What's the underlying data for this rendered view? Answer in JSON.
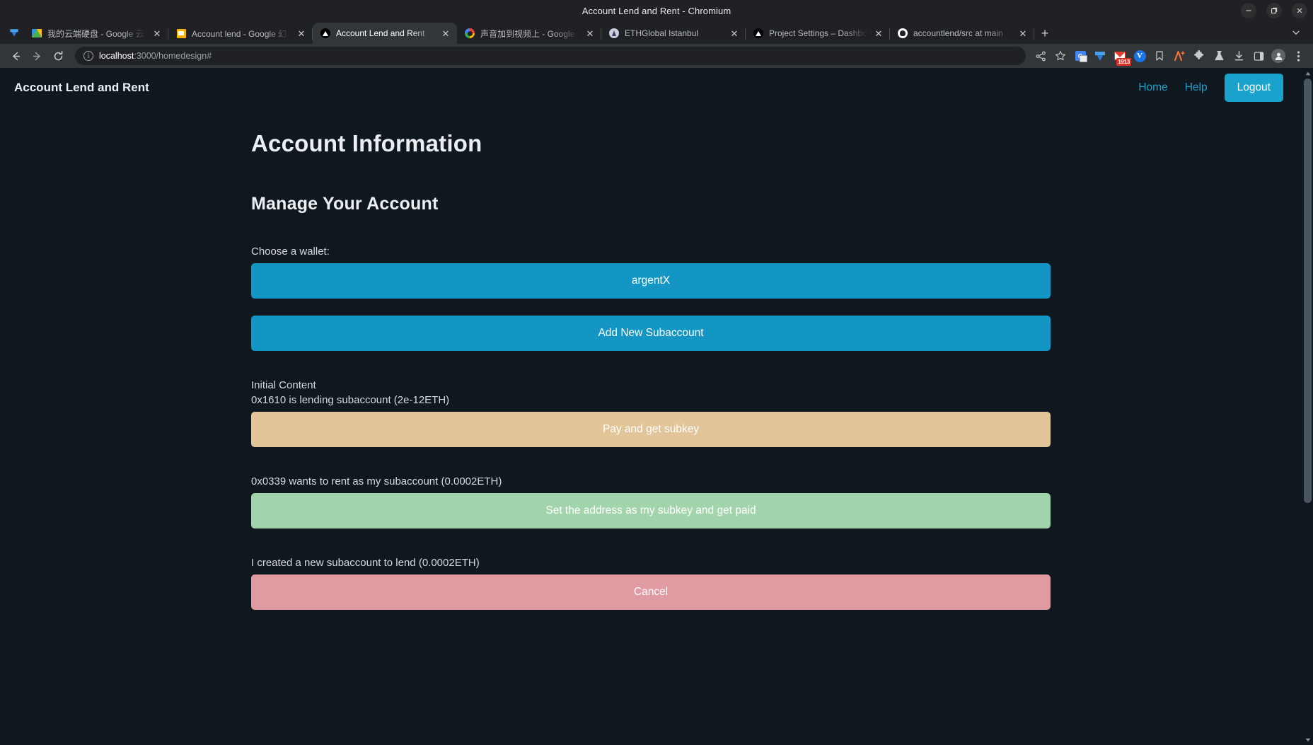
{
  "window": {
    "title": "Account Lend and Rent - Chromium",
    "controls": [
      {
        "name": "minimize",
        "glyph": "—"
      },
      {
        "name": "maximize",
        "glyph": "❐"
      },
      {
        "name": "close",
        "glyph": "✕"
      }
    ]
  },
  "tabs": [
    {
      "title": "我的云端硬盘 - Google 云…",
      "favicon": "google-drive-icon",
      "active": false
    },
    {
      "title": "Account lend - Google 幻…",
      "favicon": "google-slides-icon",
      "active": false
    },
    {
      "title": "Account Lend and Rent",
      "favicon": "triangle-icon",
      "active": true
    },
    {
      "title": "声音加到视频上 - Google…",
      "favicon": "google-search-icon",
      "active": false
    },
    {
      "title": "ETHGlobal Istanbul",
      "favicon": "ethglobal-icon",
      "active": false
    },
    {
      "title": "Project Settings – Dashbo…",
      "favicon": "vercel-icon",
      "active": false
    },
    {
      "title": "accountlend/src at main",
      "favicon": "github-icon",
      "active": false
    }
  ],
  "tabstrip": {
    "new_tab_label": "+",
    "tab_list_label": "⌄",
    "close_label": "✕"
  },
  "toolbar": {
    "back_label": "←",
    "forward_label": "→",
    "reload_label": "⟳",
    "url_host": "localhost",
    "url_path": ":3000/homedesign#",
    "info_glyph": "ⓘ",
    "icons": [
      {
        "name": "share-icon"
      },
      {
        "name": "bookmark-star-icon"
      },
      {
        "name": "google-translate-icon"
      },
      {
        "name": "gem-extension-icon"
      },
      {
        "name": "gmail-icon",
        "badge": "1913"
      },
      {
        "name": "v-circle-extension-icon",
        "glyph": "V"
      },
      {
        "name": "bookmark-flag-icon"
      },
      {
        "name": "orange-a-extension-icon",
        "glyph": "A"
      },
      {
        "name": "extensions-puzzle-icon"
      },
      {
        "name": "lab-flask-icon"
      },
      {
        "name": "downloads-icon"
      },
      {
        "name": "side-panel-icon"
      },
      {
        "name": "profile-avatar-icon"
      },
      {
        "name": "chrome-menu-icon"
      }
    ]
  },
  "site": {
    "brand": "Account Lend and Rent",
    "nav": [
      {
        "label": "Home"
      },
      {
        "label": "Help"
      }
    ],
    "logout_label": "Logout"
  },
  "main": {
    "page_title": "Account Information",
    "section_title": "Manage Your Account",
    "wallet_label": "Choose a wallet:",
    "wallet_button": "argentX",
    "add_subaccount_button": "Add New Subaccount",
    "initial_content_label": "Initial Content",
    "lending_line": "0x1610 is lending subaccount (2e-12ETH)",
    "pay_button": "Pay and get subkey",
    "rent_request_line": "0x0339 wants to rent as my subaccount (0.0002ETH)",
    "set_subkey_button": "Set the address as my subkey and get paid",
    "created_subaccount_line": "I created a new subaccount to lend (0.0002ETH)",
    "cancel_button": "Cancel"
  },
  "colors": {
    "accent_blue": "#1496c4",
    "tan": "#e2c598",
    "green": "#a2d4ab",
    "red": "#e09ba2",
    "page_bg": "#10181f",
    "link": "#1aa0c8"
  }
}
